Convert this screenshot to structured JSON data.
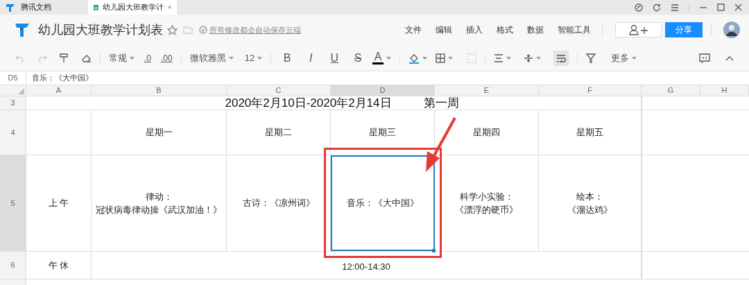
{
  "tabs": [
    {
      "label": "腾讯文档",
      "selected": false
    },
    {
      "label": "幼儿园大班教学计",
      "selected": true
    }
  ],
  "document": {
    "title": "幼儿园大班教学计划表",
    "save_status": "所有修改都会自动保存云端"
  },
  "menu": [
    "文件",
    "编辑",
    "插入",
    "格式",
    "数据",
    "智能工具"
  ],
  "share_button": "分享",
  "toolbar": {
    "number_format": "常规",
    "decrease_decimal": ".0",
    "increase_decimal": ".00",
    "font": "微软雅黑",
    "font_size": "12",
    "style_buttons": [
      "B",
      "I",
      "U",
      "S",
      "A"
    ],
    "wrap_text_on": true,
    "more": "更多"
  },
  "formula_bar": {
    "cell_ref": "D5",
    "content": "音乐：《大中国》"
  },
  "columns": [
    {
      "label": "A",
      "selected": false
    },
    {
      "label": "B",
      "selected": false
    },
    {
      "label": "C",
      "selected": false
    },
    {
      "label": "D",
      "selected": true
    },
    {
      "label": "E",
      "selected": false
    },
    {
      "label": "F",
      "selected": false
    },
    {
      "label": "G",
      "selected": false
    },
    {
      "label": "H",
      "selected": false
    }
  ],
  "rows": [
    {
      "number": "3",
      "kind": "title",
      "selected": false,
      "date_range": "2020年2月10日-2020年2月14日",
      "week": "第一周"
    },
    {
      "number": "4",
      "kind": "days",
      "selected": false,
      "cells": [
        {
          "selected": false
        },
        {
          "lines": [
            "星期一"
          ],
          "selected": false
        },
        {
          "lines": [
            "星期二"
          ],
          "selected": false
        },
        {
          "lines": [
            "星期三"
          ],
          "selected": false
        },
        {
          "lines": [
            "星期四"
          ],
          "selected": false
        },
        {
          "lines": [
            "星期五"
          ],
          "selected": false
        }
      ]
    },
    {
      "number": "5",
      "kind": "days",
      "selected": true,
      "cells": [
        {
          "lines": [
            "上 午"
          ],
          "selected": false
        },
        {
          "lines": [
            "律动：",
            "冠状病毒律动操《武汉加油！》"
          ],
          "selected": false
        },
        {
          "lines": [
            "古诗：《凉州词》"
          ],
          "selected": false
        },
        {
          "lines": [
            "音乐：《大中国》"
          ],
          "selected": true
        },
        {
          "lines": [
            "科学小实验：",
            "《漂浮的硬币》"
          ],
          "selected": false
        },
        {
          "lines": [
            "绘本：",
            "《溜达鸡》"
          ],
          "selected": false
        }
      ]
    },
    {
      "number": "6",
      "kind": "merged",
      "selected": false,
      "cells": [
        "午 休",
        "12:00-14:30"
      ]
    }
  ]
}
